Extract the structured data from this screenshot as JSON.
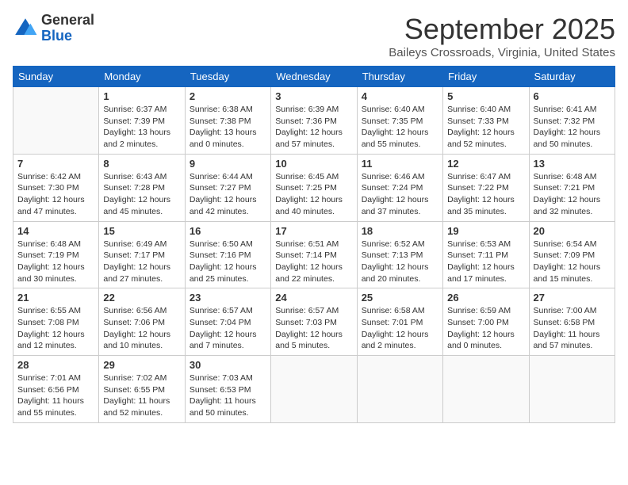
{
  "logo": {
    "general": "General",
    "blue": "Blue"
  },
  "title": "September 2025",
  "location": "Baileys Crossroads, Virginia, United States",
  "days": [
    "Sunday",
    "Monday",
    "Tuesday",
    "Wednesday",
    "Thursday",
    "Friday",
    "Saturday"
  ],
  "weeks": [
    [
      {
        "day": "",
        "sunrise": "",
        "sunset": "",
        "daylight": ""
      },
      {
        "day": "1",
        "sunrise": "Sunrise: 6:37 AM",
        "sunset": "Sunset: 7:39 PM",
        "daylight": "Daylight: 13 hours and 2 minutes."
      },
      {
        "day": "2",
        "sunrise": "Sunrise: 6:38 AM",
        "sunset": "Sunset: 7:38 PM",
        "daylight": "Daylight: 13 hours and 0 minutes."
      },
      {
        "day": "3",
        "sunrise": "Sunrise: 6:39 AM",
        "sunset": "Sunset: 7:36 PM",
        "daylight": "Daylight: 12 hours and 57 minutes."
      },
      {
        "day": "4",
        "sunrise": "Sunrise: 6:40 AM",
        "sunset": "Sunset: 7:35 PM",
        "daylight": "Daylight: 12 hours and 55 minutes."
      },
      {
        "day": "5",
        "sunrise": "Sunrise: 6:40 AM",
        "sunset": "Sunset: 7:33 PM",
        "daylight": "Daylight: 12 hours and 52 minutes."
      },
      {
        "day": "6",
        "sunrise": "Sunrise: 6:41 AM",
        "sunset": "Sunset: 7:32 PM",
        "daylight": "Daylight: 12 hours and 50 minutes."
      }
    ],
    [
      {
        "day": "7",
        "sunrise": "Sunrise: 6:42 AM",
        "sunset": "Sunset: 7:30 PM",
        "daylight": "Daylight: 12 hours and 47 minutes."
      },
      {
        "day": "8",
        "sunrise": "Sunrise: 6:43 AM",
        "sunset": "Sunset: 7:28 PM",
        "daylight": "Daylight: 12 hours and 45 minutes."
      },
      {
        "day": "9",
        "sunrise": "Sunrise: 6:44 AM",
        "sunset": "Sunset: 7:27 PM",
        "daylight": "Daylight: 12 hours and 42 minutes."
      },
      {
        "day": "10",
        "sunrise": "Sunrise: 6:45 AM",
        "sunset": "Sunset: 7:25 PM",
        "daylight": "Daylight: 12 hours and 40 minutes."
      },
      {
        "day": "11",
        "sunrise": "Sunrise: 6:46 AM",
        "sunset": "Sunset: 7:24 PM",
        "daylight": "Daylight: 12 hours and 37 minutes."
      },
      {
        "day": "12",
        "sunrise": "Sunrise: 6:47 AM",
        "sunset": "Sunset: 7:22 PM",
        "daylight": "Daylight: 12 hours and 35 minutes."
      },
      {
        "day": "13",
        "sunrise": "Sunrise: 6:48 AM",
        "sunset": "Sunset: 7:21 PM",
        "daylight": "Daylight: 12 hours and 32 minutes."
      }
    ],
    [
      {
        "day": "14",
        "sunrise": "Sunrise: 6:48 AM",
        "sunset": "Sunset: 7:19 PM",
        "daylight": "Daylight: 12 hours and 30 minutes."
      },
      {
        "day": "15",
        "sunrise": "Sunrise: 6:49 AM",
        "sunset": "Sunset: 7:17 PM",
        "daylight": "Daylight: 12 hours and 27 minutes."
      },
      {
        "day": "16",
        "sunrise": "Sunrise: 6:50 AM",
        "sunset": "Sunset: 7:16 PM",
        "daylight": "Daylight: 12 hours and 25 minutes."
      },
      {
        "day": "17",
        "sunrise": "Sunrise: 6:51 AM",
        "sunset": "Sunset: 7:14 PM",
        "daylight": "Daylight: 12 hours and 22 minutes."
      },
      {
        "day": "18",
        "sunrise": "Sunrise: 6:52 AM",
        "sunset": "Sunset: 7:13 PM",
        "daylight": "Daylight: 12 hours and 20 minutes."
      },
      {
        "day": "19",
        "sunrise": "Sunrise: 6:53 AM",
        "sunset": "Sunset: 7:11 PM",
        "daylight": "Daylight: 12 hours and 17 minutes."
      },
      {
        "day": "20",
        "sunrise": "Sunrise: 6:54 AM",
        "sunset": "Sunset: 7:09 PM",
        "daylight": "Daylight: 12 hours and 15 minutes."
      }
    ],
    [
      {
        "day": "21",
        "sunrise": "Sunrise: 6:55 AM",
        "sunset": "Sunset: 7:08 PM",
        "daylight": "Daylight: 12 hours and 12 minutes."
      },
      {
        "day": "22",
        "sunrise": "Sunrise: 6:56 AM",
        "sunset": "Sunset: 7:06 PM",
        "daylight": "Daylight: 12 hours and 10 minutes."
      },
      {
        "day": "23",
        "sunrise": "Sunrise: 6:57 AM",
        "sunset": "Sunset: 7:04 PM",
        "daylight": "Daylight: 12 hours and 7 minutes."
      },
      {
        "day": "24",
        "sunrise": "Sunrise: 6:57 AM",
        "sunset": "Sunset: 7:03 PM",
        "daylight": "Daylight: 12 hours and 5 minutes."
      },
      {
        "day": "25",
        "sunrise": "Sunrise: 6:58 AM",
        "sunset": "Sunset: 7:01 PM",
        "daylight": "Daylight: 12 hours and 2 minutes."
      },
      {
        "day": "26",
        "sunrise": "Sunrise: 6:59 AM",
        "sunset": "Sunset: 7:00 PM",
        "daylight": "Daylight: 12 hours and 0 minutes."
      },
      {
        "day": "27",
        "sunrise": "Sunrise: 7:00 AM",
        "sunset": "Sunset: 6:58 PM",
        "daylight": "Daylight: 11 hours and 57 minutes."
      }
    ],
    [
      {
        "day": "28",
        "sunrise": "Sunrise: 7:01 AM",
        "sunset": "Sunset: 6:56 PM",
        "daylight": "Daylight: 11 hours and 55 minutes."
      },
      {
        "day": "29",
        "sunrise": "Sunrise: 7:02 AM",
        "sunset": "Sunset: 6:55 PM",
        "daylight": "Daylight: 11 hours and 52 minutes."
      },
      {
        "day": "30",
        "sunrise": "Sunrise: 7:03 AM",
        "sunset": "Sunset: 6:53 PM",
        "daylight": "Daylight: 11 hours and 50 minutes."
      },
      {
        "day": "",
        "sunrise": "",
        "sunset": "",
        "daylight": ""
      },
      {
        "day": "",
        "sunrise": "",
        "sunset": "",
        "daylight": ""
      },
      {
        "day": "",
        "sunrise": "",
        "sunset": "",
        "daylight": ""
      },
      {
        "day": "",
        "sunrise": "",
        "sunset": "",
        "daylight": ""
      }
    ]
  ]
}
